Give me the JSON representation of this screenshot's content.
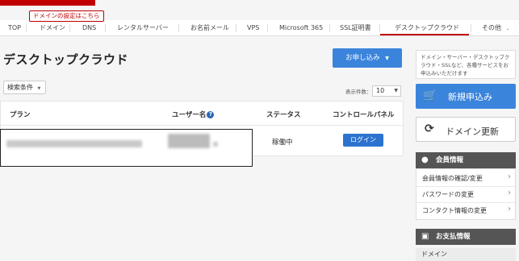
{
  "header": {
    "brand_color": "#c00000",
    "tooltip": "ドメインの設定はこちら"
  },
  "nav": {
    "items": [
      "TOP",
      "ドメイン",
      "DNS",
      "レンタルサーバー",
      "お名前メール",
      "VPS",
      "Microsoft 365",
      "SSL証明書",
      "デスクトップクラウド",
      "その他"
    ],
    "active": "デスクトップクラウド"
  },
  "main": {
    "title": "デスクトップクラウド",
    "apply_button": "お申し込み",
    "filter_button": "検索条件",
    "per_page_label": "表示件数：",
    "per_page_value": "10",
    "table": {
      "headers": [
        "プラン",
        "ユーザー名",
        "ステータス",
        "コントロールパネル"
      ],
      "rows": [
        {
          "status": "稼働中",
          "action": "ログイン"
        }
      ]
    }
  },
  "sidebar": {
    "info_text": "ドメイン・サーバー・デスクトップクラウド・SSLなど、各種サービスをお申込みいただけます",
    "new_apply_button": "新規申込み",
    "renew_button": "ドメイン更新",
    "member": {
      "title": "会員情報",
      "links": [
        "会員情報の確認/変更",
        "パスワードの変更",
        "コンタクト情報の変更"
      ]
    },
    "payment": {
      "title": "お支払情報",
      "first_item": "ドメイン"
    }
  },
  "colors": {
    "accent_blue": "#3b84dc",
    "login_blue": "#2b73cf",
    "panel_dark": "#555555",
    "active_underline": "#c00000"
  },
  "icons": [
    "cart-icon",
    "refresh-icon",
    "user-icon",
    "card-icon",
    "help-icon",
    "chevron-right-icon",
    "chevron-down-icon"
  ]
}
